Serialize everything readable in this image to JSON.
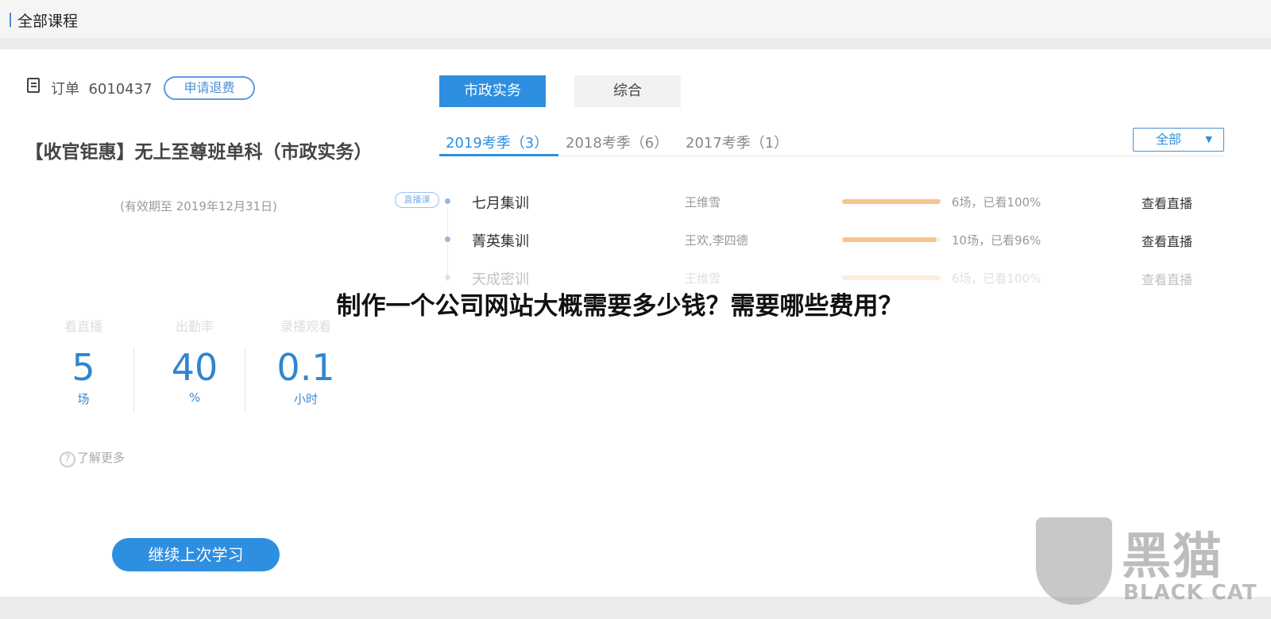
{
  "header": {
    "title": "全部课程"
  },
  "order": {
    "label": "订单",
    "number": "6010437",
    "refund_button": "申请退费"
  },
  "course": {
    "title": "【收官钜惠】无上至尊班单科（市政实务）",
    "validity": "(有效期至 2019年12月31日)"
  },
  "stats": [
    {
      "label": "看直播",
      "value": "5",
      "unit": "场"
    },
    {
      "label": "出勤率",
      "value": "40",
      "unit": "%"
    },
    {
      "label": "录播观看",
      "value": "0.1",
      "unit": "小时"
    }
  ],
  "learn_more": "了解更多",
  "continue_button": "继续上次学习",
  "subject_tabs": [
    {
      "label": "市政实务",
      "active": true
    },
    {
      "label": "综合",
      "active": false
    }
  ],
  "season_tabs": [
    {
      "label": "2019考季（3）",
      "active": true
    },
    {
      "label": "2018考季（6）"
    },
    {
      "label": "2017考季（1）"
    }
  ],
  "filter": {
    "selected": "全部"
  },
  "live_badge": "直播课",
  "sessions": [
    {
      "name": "七月集训",
      "teacher": "王维雪",
      "progress": 100,
      "summary": "6场，已看100%",
      "action": "查看直播"
    },
    {
      "name": "菁英集训",
      "teacher": "王欢,李四德",
      "progress": 96,
      "summary": "10场，已看96%",
      "action": "查看直播"
    },
    {
      "name": "天成密训",
      "teacher": "王维雪",
      "progress": 100,
      "summary": "6场，已看100%",
      "action": "查看直播"
    }
  ],
  "overlay_title": "制作一个公司网站大概需要多少钱？需要哪些费用？",
  "watermark": {
    "cn": "黑猫",
    "en": "BLACK CAT"
  },
  "colors": {
    "accent": "#2e8fe0",
    "progress": "#f8c48e"
  }
}
